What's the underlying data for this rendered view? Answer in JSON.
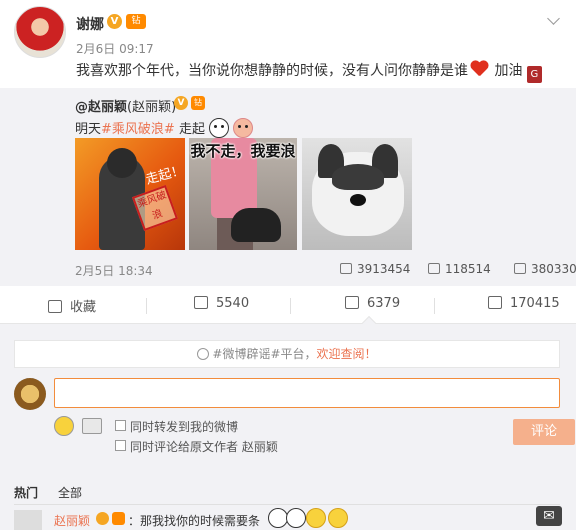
{
  "post": {
    "author": "谢娜",
    "v_badge": "V",
    "level_badge": "钻",
    "time": "2月6日 09:17",
    "text": "我喜欢那个年代，当你说你想静静的时候，没有人问你静静是谁",
    "text_tail": "加油",
    "tail_badge": "G"
  },
  "repost": {
    "author": "@赵丽颖",
    "nick": "(赵丽颖)",
    "v_badge": "V",
    "level_badge": "钻",
    "text_prefix": "明天",
    "topic": "#乘风破浪#",
    "text_suffix": "走起",
    "img1_scrawl": "走起！",
    "img1_stamp": "乘风破浪",
    "img2_caption": "我不走，我要浪",
    "time": "2月5日 18:34",
    "reposts": "3913454",
    "comments": "118514",
    "likes": "380330"
  },
  "actions": {
    "favorite": "收藏",
    "repost": "5540",
    "comment": "6379",
    "like": "170415"
  },
  "comment_box": {
    "notice_prefix": "#微博辟谣#平台，",
    "notice_link": "欢迎查阅！",
    "check1": "同时转发到我的微博",
    "check2": "同时评论给原文作者 赵丽颖",
    "submit": "评论"
  },
  "tabs": [
    "热门",
    "全部"
  ],
  "first_comment": {
    "author": "赵丽颖",
    "text": "：那我找你的时候需要条"
  },
  "watermark": "✉"
}
